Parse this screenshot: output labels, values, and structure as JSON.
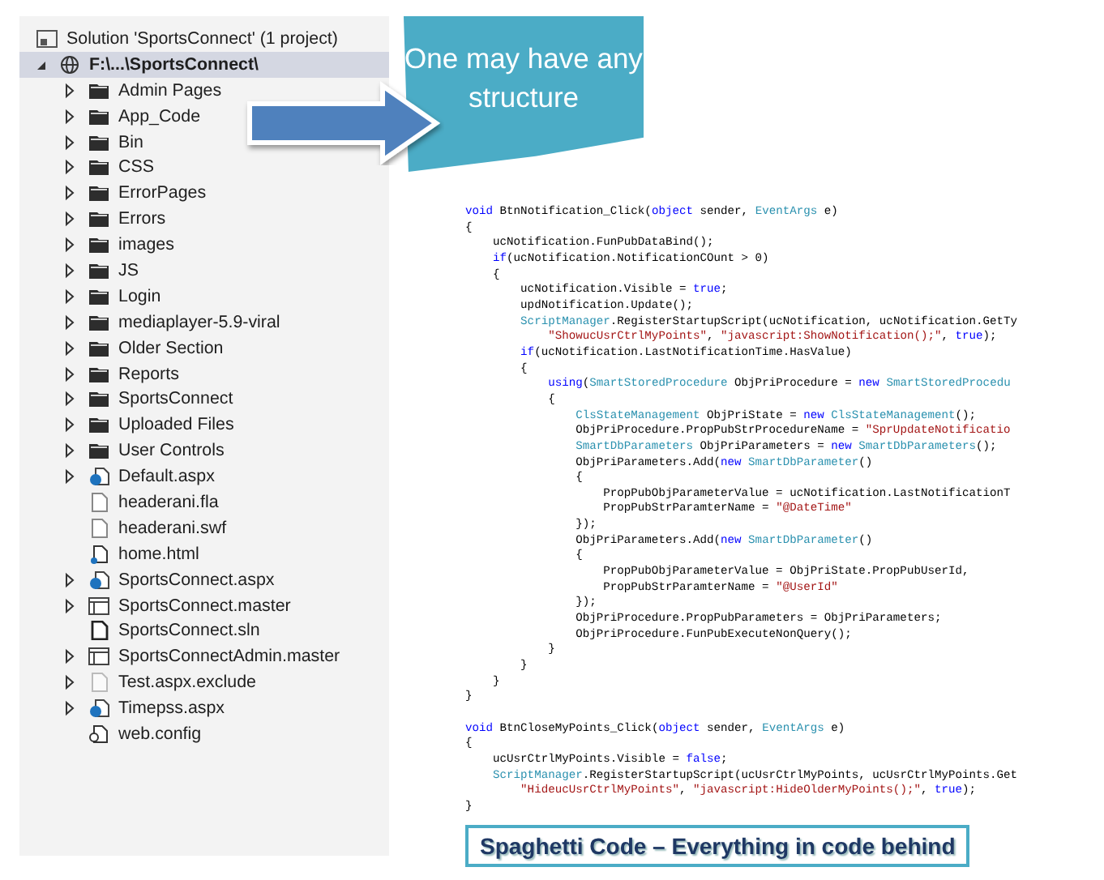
{
  "solution_explorer": {
    "tree": [
      {
        "label": "Solution 'SportsConnect' (1 project)",
        "kind": "solution",
        "selected": false,
        "children": [
          {
            "label": "F:\\...\\SportsConnect\\",
            "kind": "web-project",
            "selected": true,
            "expanded": true,
            "children": [
              {
                "label": "Admin Pages",
                "kind": "folder",
                "expandable": true,
                "selected": false
              },
              {
                "label": "App_Code",
                "kind": "folder",
                "expandable": true,
                "selected": false
              },
              {
                "label": "Bin",
                "kind": "folder",
                "expandable": true,
                "selected": false
              },
              {
                "label": "CSS",
                "kind": "folder",
                "expandable": true,
                "selected": false
              },
              {
                "label": "ErrorPages",
                "kind": "folder",
                "expandable": true,
                "selected": false
              },
              {
                "label": "Errors",
                "kind": "folder",
                "expandable": true,
                "selected": false
              },
              {
                "label": "images",
                "kind": "folder",
                "expandable": true,
                "selected": false
              },
              {
                "label": "JS",
                "kind": "folder",
                "expandable": true,
                "selected": false
              },
              {
                "label": "Login",
                "kind": "folder",
                "expandable": true,
                "selected": false
              },
              {
                "label": "mediaplayer-5.9-viral",
                "kind": "folder",
                "expandable": true,
                "selected": false
              },
              {
                "label": "Older Section",
                "kind": "folder",
                "expandable": true,
                "selected": false
              },
              {
                "label": "Reports",
                "kind": "folder",
                "expandable": true,
                "selected": false
              },
              {
                "label": "SportsConnect",
                "kind": "folder",
                "expandable": true,
                "selected": false
              },
              {
                "label": "Uploaded Files",
                "kind": "folder",
                "expandable": true,
                "selected": false
              },
              {
                "label": "User Controls",
                "kind": "folder",
                "expandable": true,
                "selected": false
              },
              {
                "label": "Default.aspx",
                "kind": "web-page",
                "expandable": true,
                "selected": false
              },
              {
                "label": "headerani.fla",
                "kind": "file",
                "expandable": false,
                "selected": false
              },
              {
                "label": "headerani.swf",
                "kind": "file",
                "expandable": false,
                "selected": false
              },
              {
                "label": "home.html",
                "kind": "html",
                "expandable": false,
                "selected": false
              },
              {
                "label": "SportsConnect.aspx",
                "kind": "web-page",
                "expandable": true,
                "selected": false
              },
              {
                "label": "SportsConnect.master",
                "kind": "master",
                "expandable": true,
                "selected": false
              },
              {
                "label": "SportsConnect.sln",
                "kind": "sln",
                "expandable": false,
                "selected": false
              },
              {
                "label": "SportsConnectAdmin.master",
                "kind": "master",
                "expandable": true,
                "selected": false
              },
              {
                "label": "Test.aspx.exclude",
                "kind": "excluded",
                "expandable": true,
                "selected": false
              },
              {
                "label": "Timepss.aspx",
                "kind": "web-page",
                "expandable": true,
                "selected": false
              },
              {
                "label": "web.config",
                "kind": "config",
                "expandable": false,
                "selected": false
              }
            ]
          }
        ]
      }
    ]
  },
  "callout": {
    "text": "One may have any structure"
  },
  "code": {
    "methods": [
      {
        "lines": [
          [
            {
              "kind": "keyword",
              "text": "void"
            },
            {
              "kind": "plain",
              "text": " BtnNotification_Click("
            },
            {
              "kind": "keyword",
              "text": "object"
            },
            {
              "kind": "plain",
              "text": " sender, "
            },
            {
              "kind": "type",
              "text": "EventArgs"
            },
            {
              "kind": "plain",
              "text": " e)"
            }
          ],
          [
            {
              "kind": "plain",
              "text": "{"
            }
          ],
          [
            {
              "kind": "plain",
              "text": "    ucNotification.FunPubDataBind();"
            }
          ],
          [
            {
              "kind": "keyword",
              "text": "    if"
            },
            {
              "kind": "plain",
              "text": "(ucNotification.NotificationCOunt > 0)"
            }
          ],
          [
            {
              "kind": "plain",
              "text": "    {"
            }
          ],
          [
            {
              "kind": "plain",
              "text": "        ucNotification.Visible = "
            },
            {
              "kind": "keyword",
              "text": "true"
            },
            {
              "kind": "plain",
              "text": ";"
            }
          ],
          [
            {
              "kind": "plain",
              "text": "        updNotification.Update();"
            }
          ],
          [
            {
              "kind": "type",
              "text": "        ScriptManager"
            },
            {
              "kind": "plain",
              "text": ".RegisterStartupScript(ucNotification, ucNotification.GetTy"
            }
          ],
          [
            {
              "kind": "string",
              "text": "            \"ShowucUsrCtrlMyPoints\""
            },
            {
              "kind": "plain",
              "text": ", "
            },
            {
              "kind": "string",
              "text": "\"javascript:ShowNotification();\""
            },
            {
              "kind": "plain",
              "text": ", "
            },
            {
              "kind": "keyword",
              "text": "true"
            },
            {
              "kind": "plain",
              "text": ");"
            }
          ],
          [
            {
              "kind": "keyword",
              "text": "        if"
            },
            {
              "kind": "plain",
              "text": "(ucNotification.LastNotificationTime.HasValue)"
            }
          ],
          [
            {
              "kind": "plain",
              "text": "        {"
            }
          ],
          [
            {
              "kind": "keyword",
              "text": "            using"
            },
            {
              "kind": "plain",
              "text": "("
            },
            {
              "kind": "type",
              "text": "SmartStoredProcedure"
            },
            {
              "kind": "plain",
              "text": " ObjPriProcedure = "
            },
            {
              "kind": "keyword",
              "text": "new"
            },
            {
              "kind": "type",
              "text": " SmartStoredProcedu"
            }
          ],
          [
            {
              "kind": "plain",
              "text": "            {"
            }
          ],
          [
            {
              "kind": "type",
              "text": "                ClsStateManagement"
            },
            {
              "kind": "plain",
              "text": " ObjPriState = "
            },
            {
              "kind": "keyword",
              "text": "new"
            },
            {
              "kind": "type",
              "text": " ClsStateManagement"
            },
            {
              "kind": "plain",
              "text": "();"
            }
          ],
          [
            {
              "kind": "plain",
              "text": "                ObjPriProcedure.PropPubStrProcedureName = "
            },
            {
              "kind": "string",
              "text": "\"SprUpdateNotificatio"
            }
          ],
          [
            {
              "kind": "type",
              "text": "                SmartDbParameters"
            },
            {
              "kind": "plain",
              "text": " ObjPriParameters = "
            },
            {
              "kind": "keyword",
              "text": "new"
            },
            {
              "kind": "type",
              "text": " SmartDbParameters"
            },
            {
              "kind": "plain",
              "text": "();"
            }
          ],
          [
            {
              "kind": "plain",
              "text": "                ObjPriParameters.Add("
            },
            {
              "kind": "keyword",
              "text": "new"
            },
            {
              "kind": "type",
              "text": " SmartDbParameter"
            },
            {
              "kind": "plain",
              "text": "()"
            }
          ],
          [
            {
              "kind": "plain",
              "text": "                {"
            }
          ],
          [
            {
              "kind": "plain",
              "text": "                    PropPubObjParameterValue = ucNotification.LastNotificationT"
            }
          ],
          [
            {
              "kind": "plain",
              "text": "                    PropPubStrParamterName = "
            },
            {
              "kind": "string",
              "text": "\"@DateTime\""
            }
          ],
          [
            {
              "kind": "plain",
              "text": "                });"
            }
          ],
          [
            {
              "kind": "plain",
              "text": "                ObjPriParameters.Add("
            },
            {
              "kind": "keyword",
              "text": "new"
            },
            {
              "kind": "type",
              "text": " SmartDbParameter"
            },
            {
              "kind": "plain",
              "text": "()"
            }
          ],
          [
            {
              "kind": "plain",
              "text": "                {"
            }
          ],
          [
            {
              "kind": "plain",
              "text": "                    PropPubObjParameterValue = ObjPriState.PropPubUserId,"
            }
          ],
          [
            {
              "kind": "plain",
              "text": "                    PropPubStrParamterName = "
            },
            {
              "kind": "string",
              "text": "\"@UserId\""
            }
          ],
          [
            {
              "kind": "plain",
              "text": "                });"
            }
          ],
          [
            {
              "kind": "plain",
              "text": "                ObjPriProcedure.PropPubParameters = ObjPriParameters;"
            }
          ],
          [
            {
              "kind": "plain",
              "text": "                ObjPriProcedure.FunPubExecuteNonQuery();"
            }
          ],
          [
            {
              "kind": "plain",
              "text": "            }"
            }
          ],
          [
            {
              "kind": "plain",
              "text": "        }"
            }
          ],
          [
            {
              "kind": "plain",
              "text": "    }"
            }
          ],
          [
            {
              "kind": "plain",
              "text": "}"
            }
          ]
        ]
      },
      {
        "lines": [
          [
            {
              "kind": "keyword",
              "text": "void"
            },
            {
              "kind": "plain",
              "text": " BtnCloseMyPoints_Click("
            },
            {
              "kind": "keyword",
              "text": "object"
            },
            {
              "kind": "plain",
              "text": " sender, "
            },
            {
              "kind": "type",
              "text": "EventArgs"
            },
            {
              "kind": "plain",
              "text": " e)"
            }
          ],
          [
            {
              "kind": "plain",
              "text": "{"
            }
          ],
          [
            {
              "kind": "plain",
              "text": "    ucUsrCtrlMyPoints.Visible = "
            },
            {
              "kind": "keyword",
              "text": "false"
            },
            {
              "kind": "plain",
              "text": ";"
            }
          ],
          [
            {
              "kind": "type",
              "text": "    ScriptManager"
            },
            {
              "kind": "plain",
              "text": ".RegisterStartupScript(ucUsrCtrlMyPoints, ucUsrCtrlMyPoints.Get"
            }
          ],
          [
            {
              "kind": "string",
              "text": "        \"HideucUsrCtrlMyPoints\""
            },
            {
              "kind": "plain",
              "text": ", "
            },
            {
              "kind": "string",
              "text": "\"javascript:HideOlderMyPoints();\""
            },
            {
              "kind": "plain",
              "text": ", "
            },
            {
              "kind": "keyword",
              "text": "true"
            },
            {
              "kind": "plain",
              "text": ");"
            }
          ],
          [
            {
              "kind": "plain",
              "text": "}"
            }
          ]
        ]
      }
    ]
  },
  "caption": {
    "text": "Spaghetti Code – Everything in code behind"
  }
}
